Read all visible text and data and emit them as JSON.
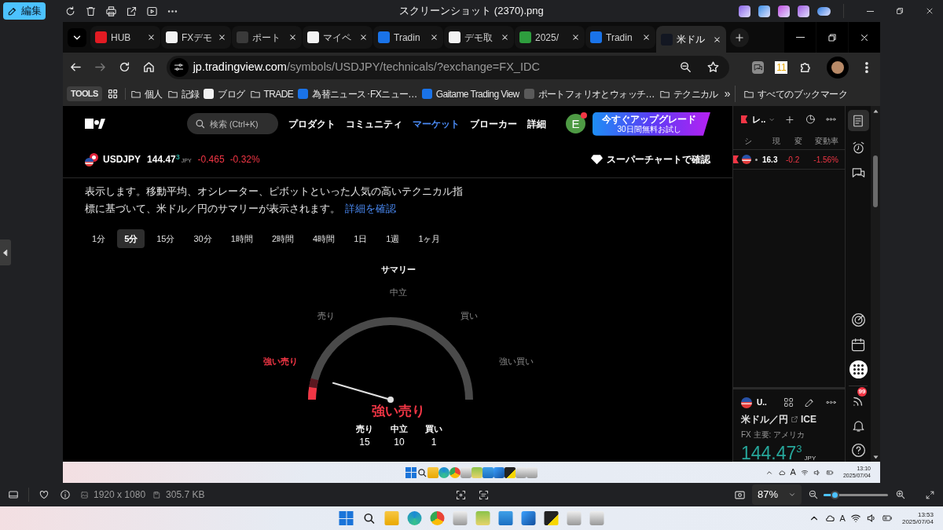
{
  "viewer": {
    "edit_button": "編集",
    "title": "スクリーンショット (2370).png",
    "dimensions": "1920 x 1080",
    "file_size": "305.7 KB",
    "zoom": "87%",
    "zoom_slider": {
      "level": 0.17
    }
  },
  "browser": {
    "tabs": [
      {
        "label": "HUB",
        "color": "#e21b23",
        "selected": false
      },
      {
        "label": "FXデモ",
        "color": "#f2f2f2",
        "selected": false
      },
      {
        "label": "ポート",
        "color": "#3a3a3a",
        "selected": false
      },
      {
        "label": "マイペ",
        "color": "#f2f2f2",
        "selected": false
      },
      {
        "label": "Tradin",
        "color": "#1a73e8",
        "selected": false
      },
      {
        "label": "デモ取",
        "color": "#f2f2f2",
        "selected": false
      },
      {
        "label": "2025/",
        "color": "#2e9e3e",
        "selected": false
      },
      {
        "label": "Tradin",
        "color": "#1a73e8",
        "selected": false
      },
      {
        "label": "米ドル",
        "color": "#131722",
        "selected": true
      }
    ],
    "url_host": "jp.tradingview.com",
    "url_path": "/symbols/USDJPY/technicals/?exchange=FX_IDC",
    "extension_badge": "11",
    "bookmarks": [
      {
        "kind": "chip",
        "label": "TOOLS"
      },
      {
        "kind": "apps"
      },
      {
        "kind": "folder",
        "label": "個人"
      },
      {
        "kind": "folder",
        "label": "記録"
      },
      {
        "kind": "site",
        "label": "ブログ",
        "color": "#f2f2f2"
      },
      {
        "kind": "folder",
        "label": "TRADE"
      },
      {
        "kind": "site",
        "label": "為替ニュース･FXニュー…",
        "color": "#1a73e8"
      },
      {
        "kind": "site",
        "label": "Gaitame Trading View",
        "color": "#1a73e8"
      },
      {
        "kind": "site",
        "label": "ポートフォリオとウォッチ…",
        "color": "#5a5a5a"
      },
      {
        "kind": "folder",
        "label": "テクニカル"
      },
      {
        "kind": "more",
        "label": "»"
      },
      {
        "kind": "folder",
        "label": "すべてのブックマーク"
      }
    ]
  },
  "page": {
    "search_placeholder": "検索 (Ctrl+K)",
    "nav": [
      {
        "label": "プロダクト",
        "selected": false
      },
      {
        "label": "コミュニティ",
        "selected": false
      },
      {
        "label": "マーケット",
        "selected": true
      },
      {
        "label": "ブローカー",
        "selected": false
      },
      {
        "label": "詳細",
        "selected": false
      }
    ],
    "avatar": "E",
    "avatar_notification": true,
    "upgrade": {
      "title": "今すぐアップグレード",
      "subtitle": "30日間無料お試し"
    },
    "symbol": {
      "ticker": "USDJPY",
      "price": "144.47",
      "price_sup": "3",
      "currency": "JPY",
      "change": "-0.465",
      "change_pct": "-0.32%"
    },
    "supercharts_link": "スーパーチャートで確認",
    "description": "表示します。移動平均、オシレーター、ピボットといった人気の高いテクニカル指標に基づいて、米ドル／円のサマリーが表示されます。",
    "description_link": "詳細を確認",
    "timeframes": [
      {
        "label": "1分",
        "selected": false
      },
      {
        "label": "5分",
        "selected": true
      },
      {
        "label": "15分",
        "selected": false
      },
      {
        "label": "30分",
        "selected": false
      },
      {
        "label": "1時間",
        "selected": false
      },
      {
        "label": "2時間",
        "selected": false
      },
      {
        "label": "4時間",
        "selected": false
      },
      {
        "label": "1日",
        "selected": false
      },
      {
        "label": "1週",
        "selected": false
      },
      {
        "label": "1ヶ月",
        "selected": false
      }
    ],
    "summary": {
      "title": "サマリー",
      "gauge_labels": [
        {
          "label": "強い売り",
          "selected": true
        },
        {
          "label": "売り",
          "selected": false
        },
        {
          "label": "中立",
          "selected": false
        },
        {
          "label": "買い",
          "selected": false
        },
        {
          "label": "強い買い",
          "selected": false
        }
      ],
      "result": "強い売り",
      "counts": [
        {
          "label": "売り",
          "value": "15"
        },
        {
          "label": "中立",
          "value": "10"
        },
        {
          "label": "買い",
          "value": "1"
        }
      ]
    }
  },
  "watchlist": {
    "title": "レ..",
    "columns": [
      "シ",
      "現",
      "変",
      "変動率"
    ],
    "rows": [
      {
        "price": "16.3",
        "change": "-0.2",
        "change_pct": "-1.56%"
      }
    ]
  },
  "details": {
    "title": "U..",
    "name": "米ドル／円",
    "exchange": "ICE",
    "category": "FX 主要: アメリカ",
    "price": "144.47",
    "price_sup": "3",
    "currency": "JPY"
  },
  "sidebar": {
    "notification_badge": "99"
  },
  "inner_taskbar": {
    "ime": "A",
    "time": "13:10",
    "date": "2025/07/04"
  },
  "taskbar": {
    "ime": "A",
    "time": "13:53",
    "date": "2025/07/04"
  }
}
